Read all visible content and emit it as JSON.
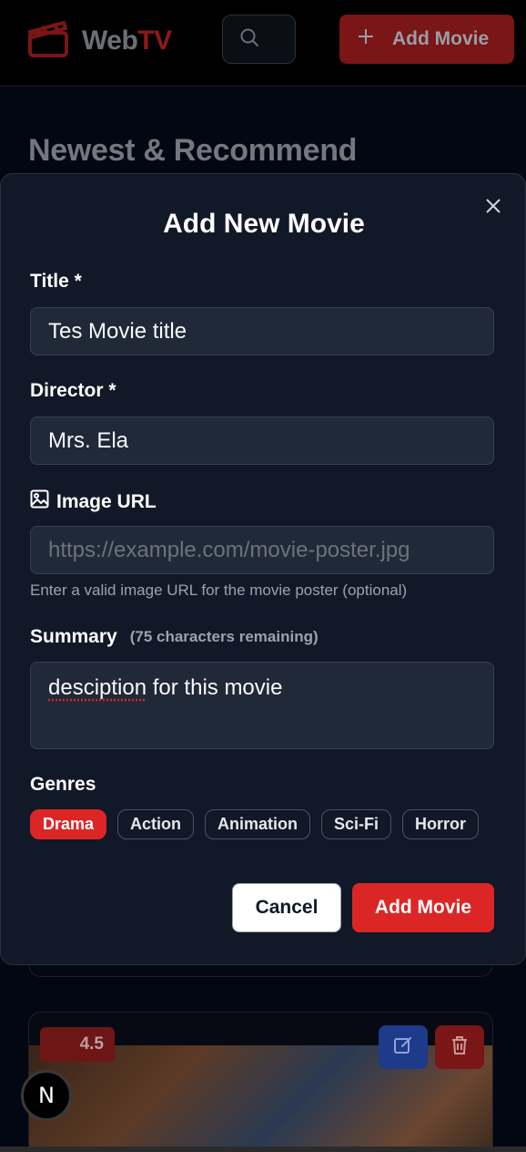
{
  "app": {
    "logo_web": "Web",
    "logo_tv": "TV",
    "add_label": "Add Movie"
  },
  "page": {
    "heading": "Newest & Recommend"
  },
  "card": {
    "rating": "4.5"
  },
  "dev_badge": "N",
  "modal": {
    "title": "Add New Movie",
    "title_label": "Title *",
    "title_value": "Tes Movie title",
    "director_label": "Director *",
    "director_value": "Mrs. Ela",
    "image_label": "Image URL",
    "image_placeholder": "https://example.com/movie-poster.jpg",
    "image_help": "Enter a valid image URL for the movie poster (optional)",
    "summary_label": "Summary",
    "summary_remaining": "(75 characters remaining)",
    "summary_misspelled": "desciption",
    "summary_rest": " for this movie",
    "genres_label": "Genres",
    "genres": [
      "Drama",
      "Action",
      "Animation",
      "Sci-Fi",
      "Horror"
    ],
    "selected_genre": "Drama",
    "cancel_label": "Cancel",
    "submit_label": "Add Movie"
  },
  "colors": {
    "accent": "#dc2626",
    "modal_bg": "#111827",
    "field_bg": "#1f2937"
  }
}
